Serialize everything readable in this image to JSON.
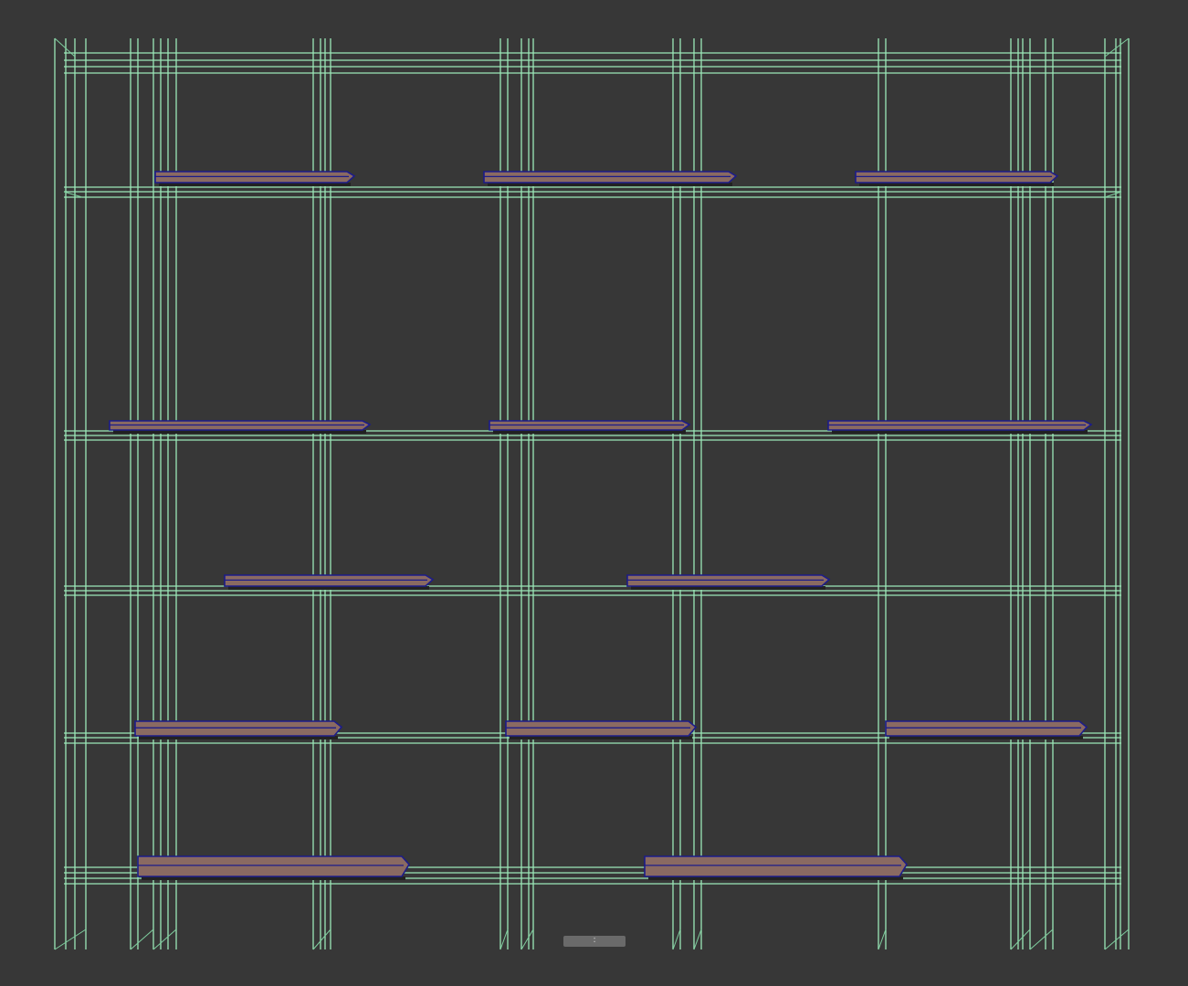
{
  "viewport": {
    "background": "#373737",
    "wire_color": "#9ce8b8",
    "shelf_color": "#8a6a62",
    "shelf_edge_color": "#1c1c8a",
    "object": "shelving-unit-wireframe",
    "shelf_count": 13
  },
  "nav_gizmo": {
    "label": ":"
  }
}
